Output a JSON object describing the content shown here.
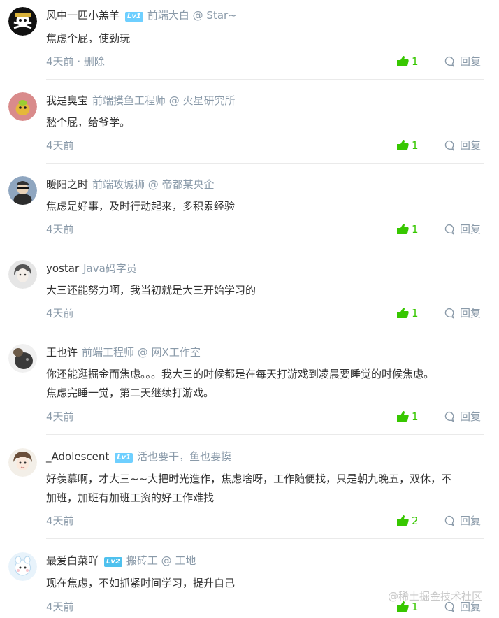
{
  "comments": [
    {
      "user": "风中一匹小羔羊",
      "level": "Lv1",
      "meta": "前端大白 @ Star~",
      "lines": [
        "焦虑个屁，使劲玩"
      ],
      "time": "4天前",
      "extra": " · 删除",
      "likes": "1",
      "reply": "回复"
    },
    {
      "user": "我是臭宝",
      "level": "",
      "meta": "前端摸鱼工程师 @ 火星研究所",
      "lines": [
        "愁个屁，给爷学。"
      ],
      "time": "4天前",
      "extra": "",
      "likes": "1",
      "reply": "回复"
    },
    {
      "user": "暖阳之时",
      "level": "",
      "meta": "前端攻城狮 @ 帝都某央企",
      "lines": [
        "焦虑是好事，及时行动起来，多积累经验"
      ],
      "time": "4天前",
      "extra": "",
      "likes": "1",
      "reply": "回复"
    },
    {
      "user": "yostar",
      "level": "",
      "meta": "Java码字员",
      "lines": [
        "大三还能努力啊，我当初就是大三开始学习的"
      ],
      "time": "4天前",
      "extra": "",
      "likes": "1",
      "reply": "回复"
    },
    {
      "user": "王也许",
      "level": "",
      "meta": "前端工程师 @ 网X工作室",
      "lines": [
        "你还能逛掘金而焦虑。。。我大三的时候都是在每天打游戏到凌晨要睡觉的时候焦虑。",
        "焦虑完睡一觉，第二天继续打游戏。"
      ],
      "time": "4天前",
      "extra": "",
      "likes": "1",
      "reply": "回复"
    },
    {
      "user": "_Adolescent",
      "level": "Lv1",
      "meta": "活也要干，鱼也要摸",
      "lines": [
        "好羡慕啊，才大三~~大把时光造作，焦虑啥呀，工作随便找，只是朝九晚五，双休，不",
        "加班，加班有加班工资的好工作难找"
      ],
      "time": "4天前",
      "extra": "",
      "likes": "2",
      "reply": "回复"
    },
    {
      "user": "最爱白菜吖",
      "level": "Lv2",
      "meta": "搬砖工 @ 工地",
      "lines": [
        "现在焦虑，不如抓紧时间学习，提升自己"
      ],
      "time": "4天前",
      "extra": "",
      "likes": "1",
      "reply": "回复"
    }
  ],
  "watermark": "@稀土掘金技术社区",
  "colors": {
    "like": "#37c700",
    "meta": "#8a9aa9",
    "level_badge": "#6ecfff"
  },
  "icons": {
    "like": "thumbs-up-icon",
    "reply": "comment-bubble-icon"
  }
}
